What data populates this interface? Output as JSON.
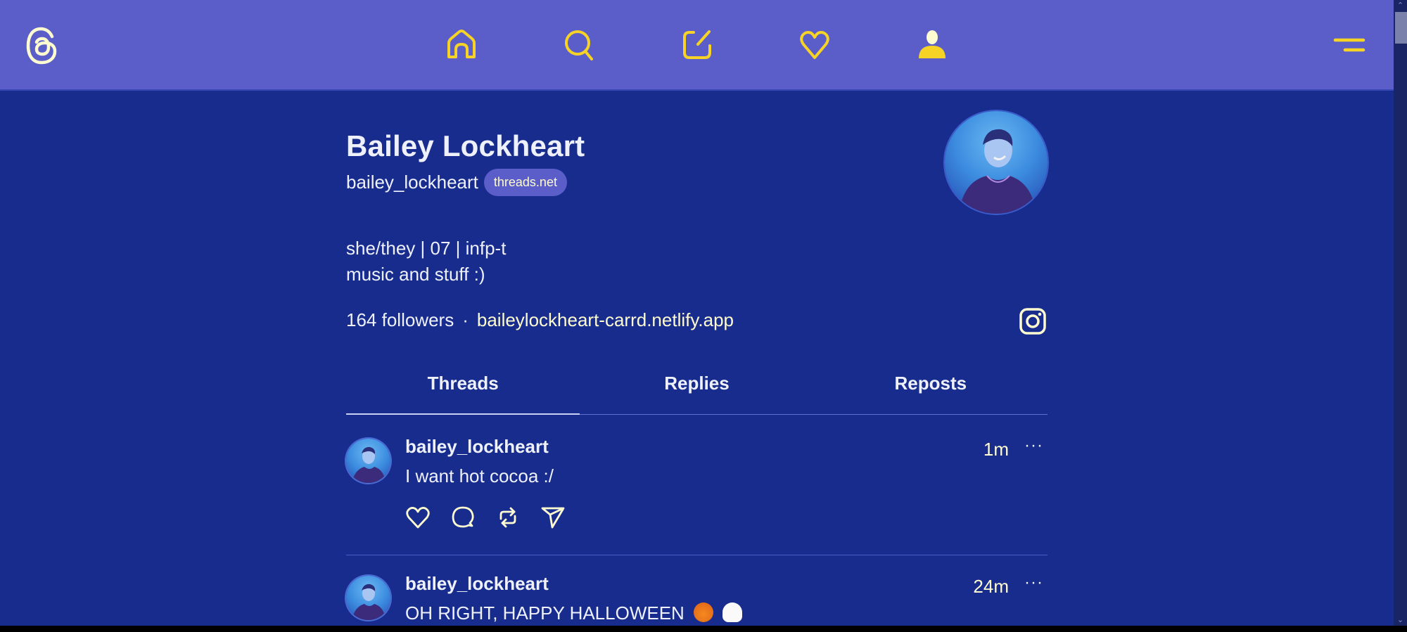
{
  "topbar": {
    "logo": "threads-logo-icon",
    "nav": [
      {
        "name": "home",
        "icon": "home-icon"
      },
      {
        "name": "search",
        "icon": "search-icon"
      },
      {
        "name": "compose",
        "icon": "compose-icon"
      },
      {
        "name": "activity",
        "icon": "heart-icon"
      },
      {
        "name": "profile",
        "icon": "person-icon"
      }
    ],
    "menu_icon": "menu-icon"
  },
  "colors": {
    "topbar_bg": "#5b5ec9",
    "page_bg": "#172c8c",
    "accent_yellow": "#f6d325",
    "cream": "#fdfbd0",
    "text": "#eef1fb"
  },
  "profile": {
    "display_name": "Bailey Lockheart",
    "handle": "bailey_lockheart",
    "badge": "threads.net",
    "bio_lines": [
      "she/they | 07 | infp-t",
      "music and stuff :)"
    ],
    "followers": "164 followers",
    "separator": "·",
    "link": "baileylockheart-carrd.netlify.app",
    "social_icon": "instagram-icon"
  },
  "tabs": [
    {
      "label": "Threads",
      "active": true
    },
    {
      "label": "Replies",
      "active": false
    },
    {
      "label": "Reposts",
      "active": false
    }
  ],
  "posts": [
    {
      "username": "bailey_lockheart",
      "text": "I want hot cocoa :/",
      "time": "1m",
      "more": "···",
      "actions": [
        "like-icon",
        "reply-icon",
        "repost-icon",
        "share-icon"
      ]
    },
    {
      "username": "bailey_lockheart",
      "text": "OH RIGHT, HAPPY HALLOWEEN",
      "emojis": [
        "jack-o-lantern",
        "ghost"
      ],
      "time": "24m",
      "more": "···"
    }
  ],
  "scrollbar": {
    "up": "⌃",
    "down": "⌄"
  }
}
